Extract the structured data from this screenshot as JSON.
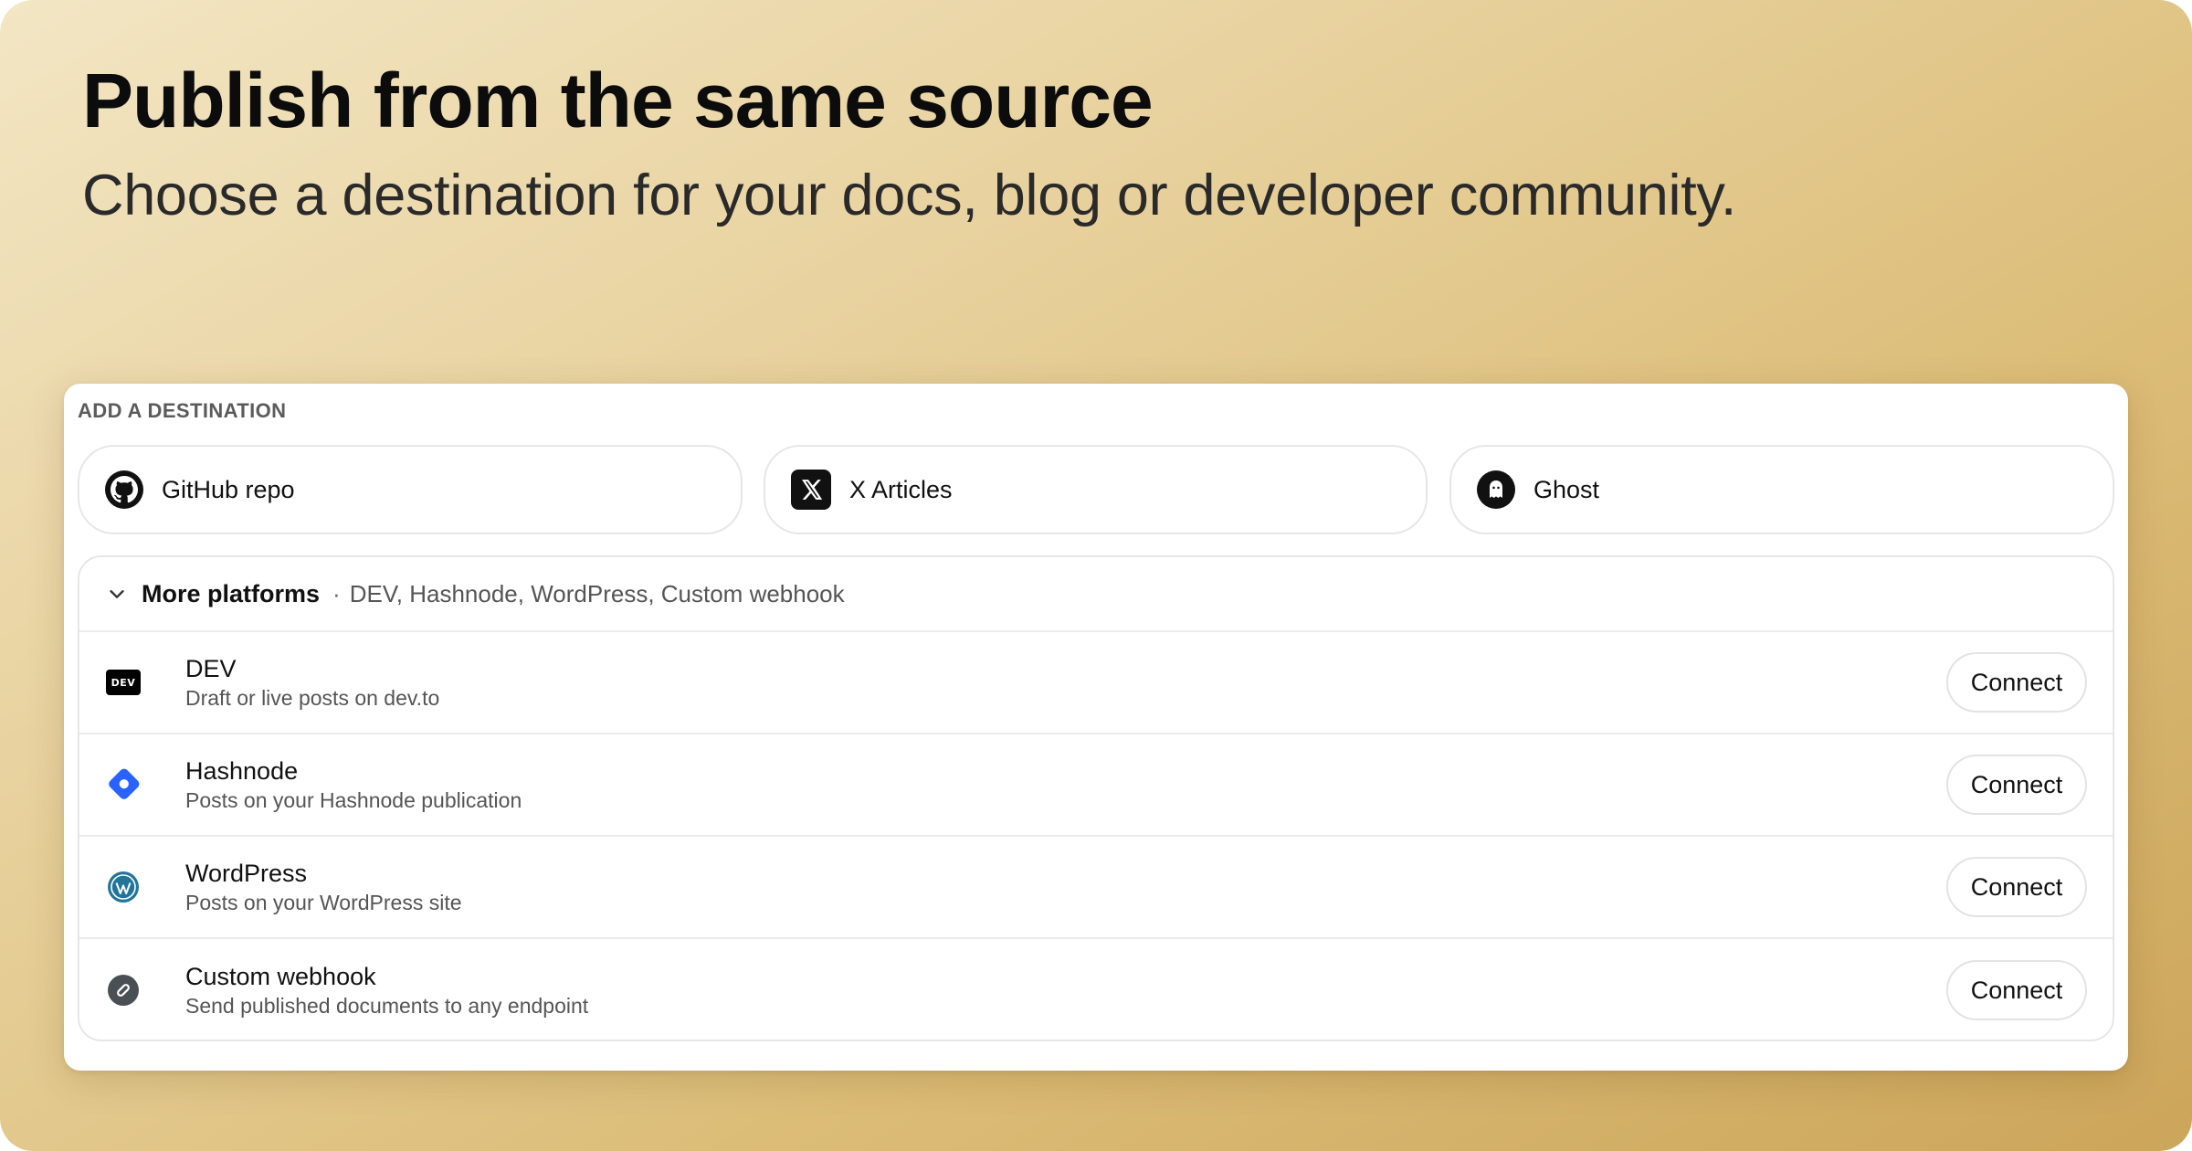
{
  "hero": {
    "title": "Publish from the same source",
    "subtitle": "Choose a destination for your docs, blog or developer community."
  },
  "destinations": {
    "section_label": "ADD A DESTINATION",
    "primary": [
      {
        "label": "GitHub repo",
        "icon": "github-icon"
      },
      {
        "label": "X Articles",
        "icon": "x-icon"
      },
      {
        "label": "Ghost",
        "icon": "ghost-icon"
      }
    ],
    "more": {
      "title": "More platforms",
      "separator": "·",
      "summary": "DEV, Hashnode, WordPress, Custom webhook",
      "expanded": true,
      "items": [
        {
          "name": "DEV",
          "description": "Draft or live posts on dev.to",
          "icon": "dev-icon",
          "badge_text": "DEV",
          "action": "Connect"
        },
        {
          "name": "Hashnode",
          "description": "Posts on your Hashnode publication",
          "icon": "hashnode-icon",
          "action": "Connect"
        },
        {
          "name": "WordPress",
          "description": "Posts on your WordPress site",
          "icon": "wordpress-icon",
          "action": "Connect"
        },
        {
          "name": "Custom webhook",
          "description": "Send published documents to any endpoint",
          "icon": "webhook-icon",
          "action": "Connect"
        }
      ]
    }
  },
  "colors": {
    "background_start": "#f3e6c4",
    "background_end": "#cca55a",
    "hashnode_blue": "#2962ff",
    "wordpress_blue": "#21759b",
    "webhook_gray": "#4a4f55"
  }
}
